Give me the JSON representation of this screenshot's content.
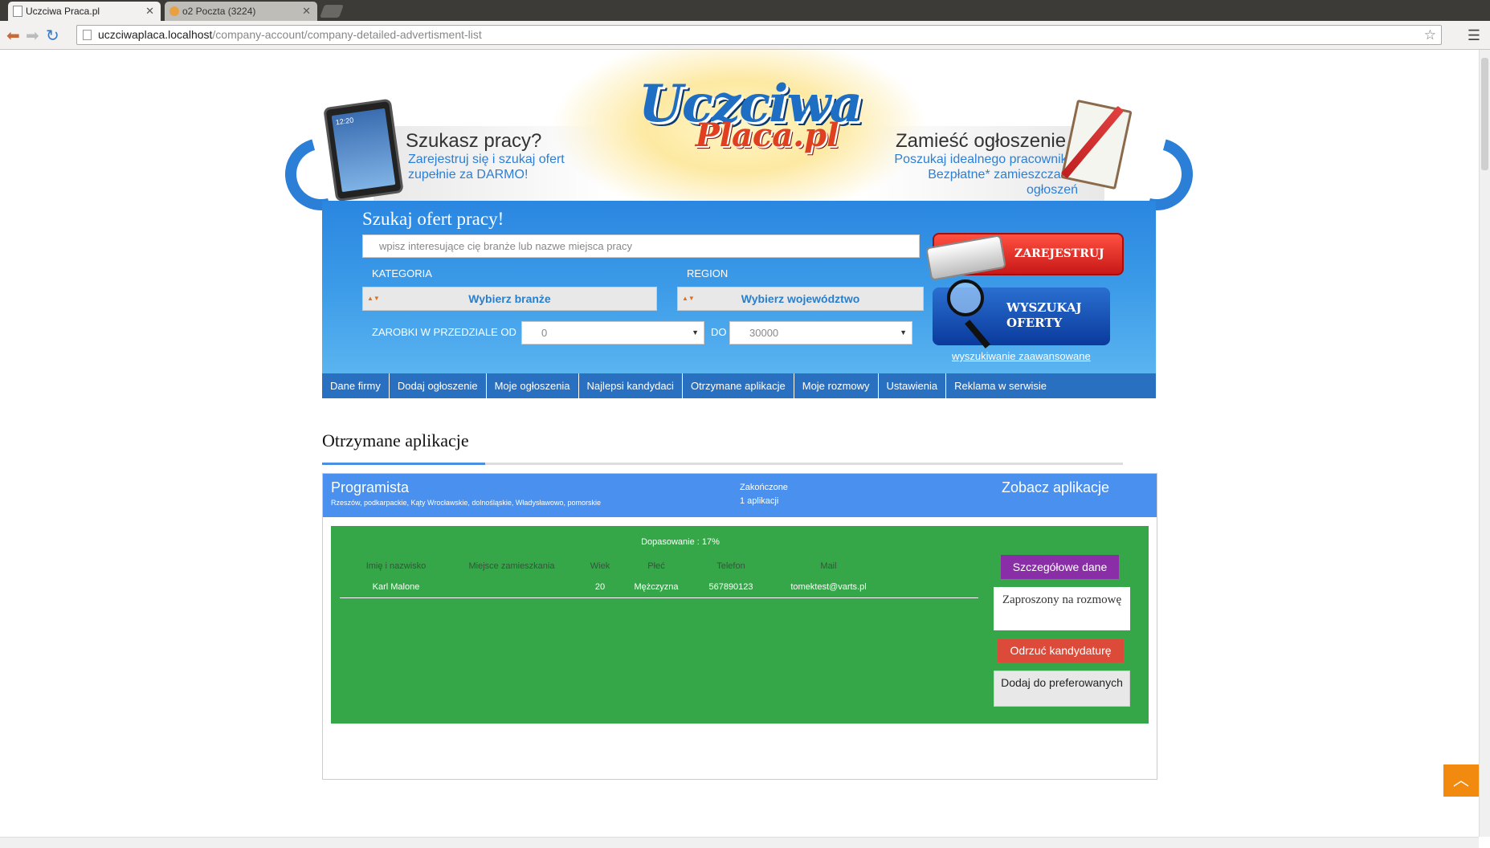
{
  "browser": {
    "tabs": [
      {
        "title": "Uczciwa Praca.pl",
        "active": true
      },
      {
        "title": "o2 Poczta (3224)",
        "active": false
      }
    ],
    "url_host": "uczciwaplaca.localhost",
    "url_path": "/company-account/company-detailed-advertisment-list"
  },
  "banner": {
    "left_title": "Szukasz pracy?",
    "left_sub": "Zarejestruj się i szukaj ofert zupełnie  za DARMO!",
    "logo_top": "Uczciwa",
    "logo_bottom": "Placa.pl",
    "right_title": "Zamieść ogłoszenie",
    "right_sub": "Poszukaj idealnego pracownika. Bezpłatne* zamieszczanie ogłoszeń",
    "tablet_time": "12:20"
  },
  "search": {
    "title": "Szukaj ofert pracy!",
    "placeholder": "wpisz interesujące cię branże lub nazwe miejsca pracy",
    "category_label": "KATEGORIA",
    "category_value": "Wybierz branże",
    "region_label": "REGION",
    "region_value": "Wybierz województwo",
    "salary_label": "ZAROBKI W PRZEDZIALE OD",
    "salary_from": "0",
    "to_label": "DO",
    "salary_to": "30000",
    "register_button": "ZAREJESTRUJ SIĘ",
    "search_button": "WYSZUKAJ OFERTY",
    "advanced_link": "wyszukiwanie zaawansowane"
  },
  "nav": [
    "Dane firmy",
    "Dodaj ogłoszenie",
    "Moje ogłoszenia",
    "Najlepsi kandydaci",
    "Otrzymane aplikacje",
    "Moje rozmowy",
    "Ustawienia",
    "Reklama w serwisie"
  ],
  "content": {
    "title": "Otrzymane aplikacje",
    "ad": {
      "title": "Programista",
      "locations": "Rzeszów, podkarpackie, Kąty Wrocławskie, dolnośląskie, Władysławowo, pomorskie",
      "status": "Zakończone",
      "count": "1 aplikacji",
      "see_link": "Zobacz aplikacje"
    },
    "applicant": {
      "match": "Dopasowanie : 17%",
      "headers": [
        "Imię i nazwisko",
        "Miejsce zamieszkania",
        "Wiek",
        "Płeć",
        "Telefon",
        "Mail"
      ],
      "values": [
        "Karl Malone",
        "",
        "20",
        "Mężczyzna",
        "567890123",
        "tomektest@varts.pl"
      ],
      "actions": {
        "details": "Szczegółowe dane",
        "invited": "Zaproszony na rozmowę",
        "reject": "Odrzuć kandydaturę",
        "prefer": "Dodaj do preferowanych"
      }
    }
  },
  "colors": {
    "nav_bg": "#2a70c0",
    "card_head": "#4a90ee",
    "applicant_bg": "#35a748",
    "details_btn": "#8a2ea8",
    "reject_btn": "#dc4a3a",
    "to_top": "#f28a10"
  }
}
